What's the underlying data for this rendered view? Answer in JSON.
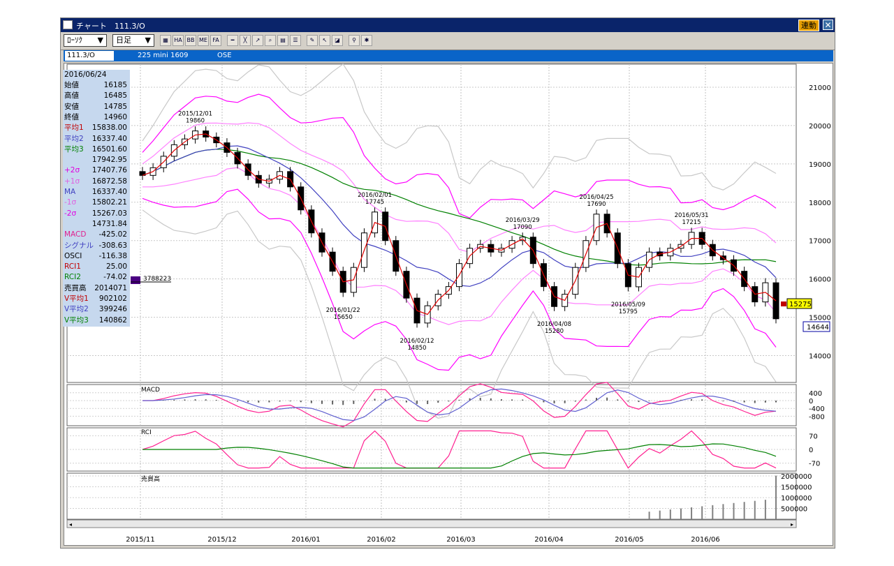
{
  "window": {
    "title": "チャート　111.3/O",
    "link_label": "連動",
    "close_glyph": "✕"
  },
  "toolbar": {
    "chart_type": "ﾛｰｿｸ",
    "period": "日足",
    "arrow": "▼",
    "icons": [
      "ha-icon",
      "bb-icon",
      "me-icon",
      "fa-icon"
    ]
  },
  "symbol_bar": {
    "code": "111.3/O",
    "name": "225 mini 1609",
    "exchange": "OSE"
  },
  "info_panel": {
    "date": "2016/06/24",
    "rows": [
      {
        "label": "始値",
        "value": "16185",
        "color": "#000000"
      },
      {
        "label": "高値",
        "value": "16485",
        "color": "#000000"
      },
      {
        "label": "安値",
        "value": "14785",
        "color": "#000000"
      },
      {
        "label": "終値",
        "value": "14960",
        "color": "#000000"
      },
      {
        "label": "平均1",
        "value": "15838.00",
        "color": "#c00000"
      },
      {
        "label": "平均2",
        "value": "16337.40",
        "color": "#4040c0"
      },
      {
        "label": "平均3",
        "value": "16501.60",
        "color": "#008000"
      },
      {
        "label": "",
        "value": "17942.95",
        "color": "#000000"
      },
      {
        "label": "+2σ",
        "value": "17407.76",
        "color": "#e000e0"
      },
      {
        "label": "+1σ",
        "value": "16872.58",
        "color": "#e060e0"
      },
      {
        "label": "MA",
        "value": "16337.40",
        "color": "#4040c0"
      },
      {
        "label": "-1σ",
        "value": "15802.21",
        "color": "#e060e0"
      },
      {
        "label": "-2σ",
        "value": "15267.03",
        "color": "#e000e0"
      },
      {
        "label": "",
        "value": "14731.84",
        "color": "#000000"
      },
      {
        "label": "MACD",
        "value": "-425.02",
        "color": "#e0208e"
      },
      {
        "label": "シグナル",
        "value": "-308.63",
        "color": "#4040c0"
      },
      {
        "label": "OSCI",
        "value": "-116.38",
        "color": "#000000"
      },
      {
        "label": "RCI1",
        "value": "25.00",
        "color": "#c00000"
      },
      {
        "label": "RCI2",
        "value": "-74.02",
        "color": "#008000"
      },
      {
        "label": "売買高",
        "value": "2014071",
        "color": "#000000"
      },
      {
        "label": "V平均1",
        "value": "902102",
        "color": "#c00000"
      },
      {
        "label": "V平均2",
        "value": "399246",
        "color": "#4040c0"
      },
      {
        "label": "V平均3",
        "value": "140862",
        "color": "#008000"
      }
    ]
  },
  "volume_marker": "3788223",
  "current_price_tag": "15275",
  "low_price_tag": "14644",
  "panel_labels": {
    "macd": "MACD",
    "rci": "RCI",
    "volume": "売買高"
  },
  "colors": {
    "candle_body": "#000000",
    "ma1": "#e00000",
    "ma2": "#4040c0",
    "ma3": "#008000",
    "bb2": "#ff00ff",
    "bb1": "#ff80ff",
    "bb3": "#c8c8c8",
    "macd": "#ff2090",
    "signal": "#6060d0",
    "rci1": "#ff2090",
    "rci2": "#008000",
    "price_tag": "#ffff00"
  },
  "chart_data": {
    "type": "candlestick",
    "x_ticks": [
      "2015/11",
      "2015/12",
      "2016/01",
      "2016/02",
      "2016/03",
      "2016/04",
      "2016/05",
      "2016/06"
    ],
    "y_ticks": [
      14000,
      15000,
      16000,
      17000,
      18000,
      19000,
      20000,
      21000
    ],
    "ylim": [
      13300,
      21600
    ],
    "key_points": [
      {
        "date": "2015/12/01",
        "value": 19860,
        "label": "2015/12/01\n19860"
      },
      {
        "date": "2016/01/22",
        "value": 15650,
        "label": "2016/01/22\n15650"
      },
      {
        "date": "2016/02/01",
        "value": 17745,
        "label": "2016/02/01\n17745"
      },
      {
        "date": "2016/02/12",
        "value": 14850,
        "label": "2016/02/12\n14850"
      },
      {
        "date": "2016/03/29",
        "value": 17090,
        "label": "2016/03/29\n17090"
      },
      {
        "date": "2016/04/08",
        "value": 15280,
        "label": "2016/04/08\n15280"
      },
      {
        "date": "2016/04/25",
        "value": 17690,
        "label": "2016/04/25\n17690"
      },
      {
        "date": "2016/05/09",
        "value": 15795,
        "label": "2016/05/09\n15795"
      },
      {
        "date": "2016/05/31",
        "value": 17215,
        "label": "2016/05/31\n17215"
      },
      {
        "date": "2016/06/24",
        "value": 14960
      }
    ],
    "close_path": [
      18700,
      18900,
      19200,
      19500,
      19650,
      19860,
      19700,
      19550,
      19300,
      19000,
      18700,
      18500,
      18600,
      18800,
      18400,
      17800,
      17200,
      16700,
      16200,
      15650,
      16300,
      17200,
      17745,
      17000,
      16200,
      15500,
      14850,
      15300,
      15600,
      15800,
      16400,
      16800,
      16900,
      16700,
      16800,
      17000,
      17090,
      16400,
      15800,
      15280,
      15600,
      16300,
      17000,
      17690,
      17200,
      16400,
      15795,
      16300,
      16700,
      16600,
      16800,
      16900,
      17215,
      16900,
      16600,
      16500,
      16200,
      15800,
      15400,
      15900,
      14960
    ],
    "macd_yticks": [
      400,
      0,
      -400,
      -800
    ],
    "rci_yticks": [
      70,
      0,
      -70
    ],
    "volume_yticks": [
      2000000,
      1500000,
      1000000,
      500000
    ]
  }
}
